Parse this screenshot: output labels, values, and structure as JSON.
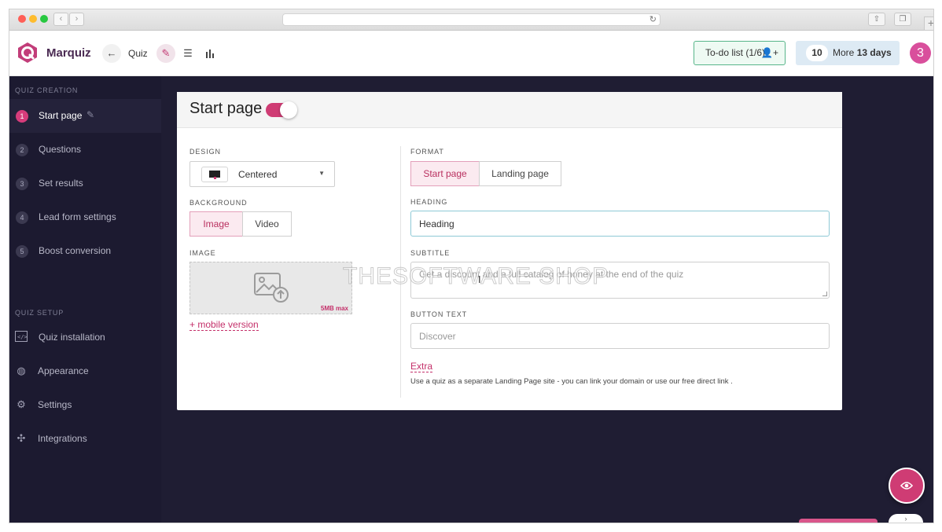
{
  "header": {
    "brand": "Marquiz",
    "quiz_label": "Quiz",
    "todo_label": "To-do list (1/6)",
    "trial_count": "10",
    "trial_text_prefix": "More",
    "trial_text_bold": "13 days",
    "avatar_number": "3"
  },
  "sidebar": {
    "creation_label": "QUIZ CREATION",
    "steps": [
      {
        "num": "1",
        "label": "Start page"
      },
      {
        "num": "2",
        "label": "Questions"
      },
      {
        "num": "3",
        "label": "Set results"
      },
      {
        "num": "4",
        "label": "Lead form settings"
      },
      {
        "num": "5",
        "label": "Boost conversion"
      }
    ],
    "setup_label": "QUIZ SETUP",
    "setup_items": [
      {
        "label": "Quiz installation",
        "icon": "code-icon"
      },
      {
        "label": "Appearance",
        "icon": "palette-icon"
      },
      {
        "label": "Settings",
        "icon": "gear-icon"
      },
      {
        "label": "Integrations",
        "icon": "puzzle-icon"
      }
    ]
  },
  "card": {
    "title": "Start page",
    "design_label": "DESIGN",
    "design_value": "Centered",
    "background_label": "BACKGROUND",
    "background_options": [
      "Image",
      "Video"
    ],
    "image_label": "IMAGE",
    "image_max": "5MB max",
    "mobile_link": "+ mobile version",
    "format_label": "FORMAT",
    "format_options": [
      "Start page",
      "Landing page"
    ],
    "heading_label": "HEADING",
    "heading_value": "Heading",
    "subtitle_label": "SUBTITLE",
    "subtitle_placeholder": "Get a discount and a full catalog of honey at the end of the quiz",
    "button_text_label": "BUTTON TEXT",
    "button_text_placeholder": "Discover",
    "extra_link": "Extra",
    "hint": "Use a quiz as a separate Landing Page site - you can link your domain or use our free direct link ."
  },
  "watermark": "THESOFTWARE SHOP",
  "colors": {
    "accent": "#cf3c74",
    "sidebar_bg": "#1c1a30",
    "main_bg": "#1f1d33",
    "todo_border": "#58b58a"
  }
}
